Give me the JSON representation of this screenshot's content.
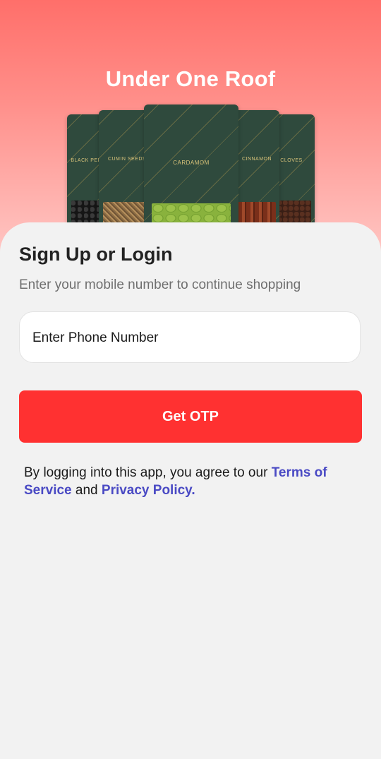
{
  "header": {
    "title": "Under One Roof",
    "packets": [
      {
        "label": "BLACK PEPPER"
      },
      {
        "label": "CUMIN SEEDS"
      },
      {
        "label": "CARDAMOM"
      },
      {
        "label": "CINNAMON"
      },
      {
        "label": "CLOVES"
      }
    ]
  },
  "login": {
    "heading": "Sign Up or Login",
    "subtext": "Enter your mobile number to continue shopping",
    "phone": {
      "placeholder": "Enter Phone Number",
      "value": ""
    },
    "button_label": "Get OTP",
    "terms": {
      "prefix": "By logging into this app, you agree to our ",
      "tos_link": "Terms of Service",
      "middle": " and ",
      "privacy_link": "Privacy Policy."
    }
  },
  "colors": {
    "accent": "#ff3131",
    "link": "#4a4ac4",
    "hero_top": "#ff6f6a",
    "pack_green": "#2f4a3d"
  }
}
